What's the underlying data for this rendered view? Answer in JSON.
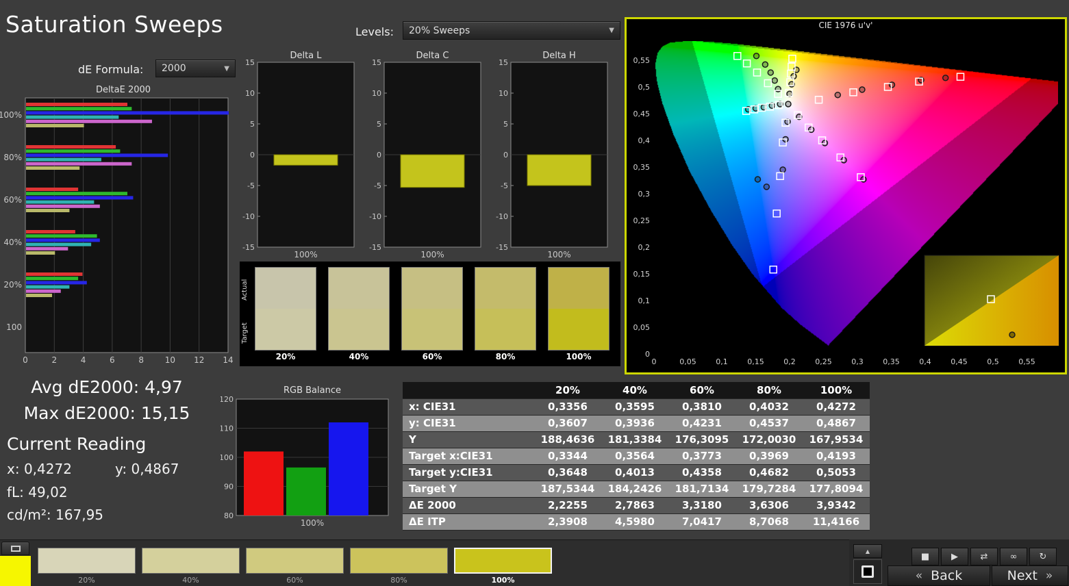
{
  "page": {
    "title": "Saturation Sweeps"
  },
  "colors": {
    "cie_border": "#ccd600",
    "panel_bg": "#000000",
    "body_bg": "#3c3c3c"
  },
  "controls": {
    "de_formula": {
      "label": "dE Formula:",
      "value": "2000"
    },
    "levels": {
      "label": "Levels:",
      "value": "20% Sweeps"
    }
  },
  "stats": {
    "avg_label": "Avg dE2000:",
    "avg_value": "4,97",
    "max_label": "Max dE2000:",
    "max_value": "15,15"
  },
  "current_reading": {
    "heading": "Current Reading",
    "x_label": "x:",
    "x_value": "0,4272",
    "y_label": "y:",
    "y_value": "0,4867",
    "fl_label": "fL:",
    "fl_value": "49,02",
    "cd_label": "cd/m²:",
    "cd_value": "167,95"
  },
  "chart_data": [
    {
      "id": "delta_e_2000",
      "type": "bar",
      "orientation": "horizontal",
      "title": "DeltaE 2000",
      "group_labels": [
        "100%",
        "80%",
        "60%",
        "40%",
        "20%",
        "100"
      ],
      "xlim": [
        0,
        14
      ],
      "xticks": [
        0,
        2,
        4,
        6,
        8,
        10,
        12,
        14
      ],
      "xtick_labels": [
        "0",
        "2",
        "4",
        "6",
        "8",
        "10",
        "12",
        "14"
      ],
      "series": [
        {
          "name": "red",
          "color": "#e03434",
          "values": [
            7.0,
            6.2,
            3.6,
            3.4,
            3.9,
            0
          ]
        },
        {
          "name": "green",
          "color": "#2eb82e",
          "values": [
            7.3,
            6.5,
            7.0,
            4.9,
            3.6,
            0
          ]
        },
        {
          "name": "blue",
          "color": "#2626e6",
          "values": [
            14.7,
            9.8,
            7.4,
            5.1,
            4.2,
            0
          ]
        },
        {
          "name": "cyan",
          "color": "#2fb3b3",
          "values": [
            6.4,
            5.2,
            4.7,
            4.5,
            3.0,
            0
          ]
        },
        {
          "name": "magenta",
          "color": "#cc66cc",
          "values": [
            8.7,
            7.3,
            5.1,
            2.9,
            2.4,
            0
          ]
        },
        {
          "name": "yellow",
          "color": "#b9b96a",
          "values": [
            4.0,
            3.7,
            3.0,
            2.0,
            1.8,
            0
          ]
        }
      ]
    },
    {
      "id": "delta_l",
      "type": "bar",
      "title": "Delta L",
      "categories": [
        "100%"
      ],
      "values": [
        -1.7
      ],
      "ylim": [
        -15,
        15
      ],
      "ytick_labels": [
        "15",
        "10",
        "5",
        "0",
        "-5",
        "-10",
        "-15"
      ],
      "xlabel": "100%",
      "bar_color": "#c4c41c"
    },
    {
      "id": "delta_c",
      "type": "bar",
      "title": "Delta C",
      "categories": [
        "100%"
      ],
      "values": [
        -5.3
      ],
      "ylim": [
        -15,
        15
      ],
      "ytick_labels": [
        "15",
        "10",
        "5",
        "0",
        "-5",
        "-10",
        "-15"
      ],
      "xlabel": "100%",
      "bar_color": "#c4c41c"
    },
    {
      "id": "delta_h",
      "type": "bar",
      "title": "Delta H",
      "categories": [
        "100%"
      ],
      "values": [
        -5.0
      ],
      "ylim": [
        -15,
        15
      ],
      "ytick_labels": [
        "15",
        "10",
        "5",
        "0",
        "-5",
        "-10",
        "-15"
      ],
      "xlabel": "100%",
      "bar_color": "#c4c41c"
    },
    {
      "id": "rgb_balance",
      "type": "bar",
      "title": "RGB Balance",
      "categories": [
        "Red",
        "Green",
        "Blue"
      ],
      "values": [
        102,
        96.5,
        112
      ],
      "colors": [
        "#ee1212",
        "#12a012",
        "#1616ee"
      ],
      "ylim": [
        80,
        120
      ],
      "yticks": [
        120,
        110,
        100,
        90,
        80
      ],
      "ytick_labels": [
        "120",
        "110",
        "100",
        "90",
        "80"
      ],
      "xlabel": "100%"
    },
    {
      "id": "cie_1976",
      "type": "scatter",
      "title": "CIE 1976 u'v'",
      "xlim": [
        0,
        0.6
      ],
      "ylim": [
        0,
        0.6
      ],
      "xtick_labels": [
        "0",
        "0,05",
        "0,1",
        "0,15",
        "0,2",
        "0,25",
        "0,3",
        "0,35",
        "0,4",
        "0,45",
        "0,5",
        "0,55"
      ],
      "ytick_labels": [
        "0",
        "0,05",
        "0,1",
        "0,15",
        "0,2",
        "0,25",
        "0,3",
        "0,35",
        "0,4",
        "0,45",
        "0,5",
        "0,55"
      ],
      "locus": [
        [
          0.2565,
          0.0165
        ],
        [
          0.2161,
          0.0549
        ],
        [
          0.1877,
          0.0871
        ],
        [
          0.1441,
          0.151
        ],
        [
          0.1147,
          0.2044
        ],
        [
          0.0828,
          0.2708
        ],
        [
          0.0521,
          0.3427
        ],
        [
          0.0282,
          0.4117
        ],
        [
          0.0119,
          0.4698
        ],
        [
          0.0035,
          0.5131
        ],
        [
          0.0014,
          0.5432
        ],
        [
          0.0046,
          0.5638
        ],
        [
          0.0123,
          0.577
        ],
        [
          0.0231,
          0.5837
        ],
        [
          0.0501,
          0.5868
        ],
        [
          0.0792,
          0.5856
        ],
        [
          0.1127,
          0.5821
        ],
        [
          0.1531,
          0.5765
        ],
        [
          0.2026,
          0.5693
        ],
        [
          0.2623,
          0.5604
        ],
        [
          0.3315,
          0.5501
        ],
        [
          0.4035,
          0.5393
        ],
        [
          0.4692,
          0.5296
        ],
        [
          0.5203,
          0.5219
        ],
        [
          0.5709,
          0.5143
        ],
        [
          0.6234,
          0.5065
        ]
      ],
      "gamut_triangle": [
        [
          0.0556,
          0.5868
        ],
        [
          0.5566,
          0.5165
        ],
        [
          0.1593,
          0.1258
        ]
      ],
      "target_squares": [
        [
          0.243,
          0.476
        ],
        [
          0.294,
          0.49
        ],
        [
          0.345,
          0.5
        ],
        [
          0.391,
          0.51
        ],
        [
          0.452,
          0.519
        ],
        [
          0.183,
          0.487
        ],
        [
          0.168,
          0.507
        ],
        [
          0.152,
          0.527
        ],
        [
          0.137,
          0.544
        ],
        [
          0.123,
          0.558
        ],
        [
          0.194,
          0.433
        ],
        [
          0.19,
          0.396
        ],
        [
          0.186,
          0.333
        ],
        [
          0.181,
          0.263
        ],
        [
          0.176,
          0.158
        ],
        [
          0.184,
          0.466
        ],
        [
          0.171,
          0.463
        ],
        [
          0.159,
          0.461
        ],
        [
          0.148,
          0.458
        ],
        [
          0.136,
          0.455
        ],
        [
          0.212,
          0.447
        ],
        [
          0.228,
          0.424
        ],
        [
          0.248,
          0.4
        ],
        [
          0.275,
          0.368
        ],
        [
          0.305,
          0.331
        ],
        [
          0.199,
          0.489
        ],
        [
          0.201,
          0.509
        ],
        [
          0.202,
          0.525
        ],
        [
          0.203,
          0.538
        ],
        [
          0.204,
          0.553
        ]
      ],
      "measured_points": [
        [
          0.271,
          0.485
        ],
        [
          0.307,
          0.495
        ],
        [
          0.351,
          0.504
        ],
        [
          0.394,
          0.513
        ],
        [
          0.43,
          0.517
        ],
        [
          0.183,
          0.496
        ],
        [
          0.178,
          0.512
        ],
        [
          0.172,
          0.527
        ],
        [
          0.164,
          0.542
        ],
        [
          0.151,
          0.558
        ],
        [
          0.197,
          0.435
        ],
        [
          0.194,
          0.402
        ],
        [
          0.19,
          0.345
        ],
        [
          0.166,
          0.313
        ],
        [
          0.153,
          0.327
        ],
        [
          0.186,
          0.468
        ],
        [
          0.174,
          0.465
        ],
        [
          0.162,
          0.462
        ],
        [
          0.15,
          0.46
        ],
        [
          0.139,
          0.458
        ],
        [
          0.214,
          0.444
        ],
        [
          0.232,
          0.42
        ],
        [
          0.252,
          0.395
        ],
        [
          0.28,
          0.363
        ],
        [
          0.309,
          0.327
        ],
        [
          0.2,
          0.487
        ],
        [
          0.203,
          0.505
        ],
        [
          0.206,
          0.52
        ],
        [
          0.21,
          0.532
        ],
        [
          0.198,
          0.468
        ]
      ],
      "inset": {
        "base_colors": [
          "#45450a",
          "#bcbc10"
        ],
        "tri_colors": [
          "#dcdc06",
          "#d88f00"
        ],
        "square": [
          535,
          412
        ],
        "circle": [
          566,
          464
        ]
      }
    }
  ],
  "swatch_compare": {
    "row_labels": [
      "Actual",
      "Target"
    ],
    "items": [
      {
        "label": "20%",
        "actual": "#c8c5ab",
        "target": "#ccc9a6"
      },
      {
        "label": "40%",
        "actual": "#c8c399",
        "target": "#cac590"
      },
      {
        "label": "60%",
        "actual": "#c6bf83",
        "target": "#c8c277"
      },
      {
        "label": "80%",
        "actual": "#c4bb6b",
        "target": "#c6bf59"
      },
      {
        "label": "100%",
        "actual": "#bfb148",
        "target": "#c2bc1d"
      }
    ]
  },
  "table": {
    "headers": [
      "",
      "20%",
      "40%",
      "60%",
      "80%",
      "100%"
    ],
    "rows": [
      {
        "label": "x: CIE31",
        "values": [
          "0,3356",
          "0,3595",
          "0,3810",
          "0,4032",
          "0,4272"
        ]
      },
      {
        "label": "y: CIE31",
        "values": [
          "0,3607",
          "0,3936",
          "0,4231",
          "0,4537",
          "0,4867"
        ]
      },
      {
        "label": "Y",
        "values": [
          "188,4636",
          "181,3384",
          "176,3095",
          "172,0030",
          "167,9534"
        ]
      },
      {
        "label": "Target x:CIE31",
        "values": [
          "0,3344",
          "0,3564",
          "0,3773",
          "0,3969",
          "0,4193"
        ]
      },
      {
        "label": "Target y:CIE31",
        "values": [
          "0,3648",
          "0,4013",
          "0,4358",
          "0,4682",
          "0,5053"
        ]
      },
      {
        "label": "Target Y",
        "values": [
          "187,5344",
          "184,2426",
          "181,7134",
          "179,7284",
          "177,8094"
        ]
      },
      {
        "label": "ΔE 2000",
        "values": [
          "2,2255",
          "2,7863",
          "3,3180",
          "3,6306",
          "3,9342"
        ]
      },
      {
        "label": "ΔE ITP",
        "values": [
          "2,3908",
          "4,5980",
          "7,0417",
          "8,7068",
          "11,4166"
        ]
      }
    ]
  },
  "bottom_bar": {
    "current_color": "#f6f600",
    "tiles": [
      {
        "label": "20%",
        "color": "#d8d5b8",
        "selected": false
      },
      {
        "label": "40%",
        "color": "#d4d09c",
        "selected": false
      },
      {
        "label": "60%",
        "color": "#d0ca7f",
        "selected": false
      },
      {
        "label": "80%",
        "color": "#ccc35c",
        "selected": false
      },
      {
        "label": "100%",
        "color": "#c9c31c",
        "selected": true
      }
    ],
    "transport": [
      {
        "name": "stop-button",
        "icon": "stop-icon",
        "glyph": "■"
      },
      {
        "name": "play-button",
        "icon": "play-icon",
        "glyph": "▶"
      },
      {
        "name": "step-button",
        "icon": "step-icon",
        "glyph": "⇄"
      },
      {
        "name": "loop-button",
        "icon": "infinity-icon",
        "glyph": "∞"
      },
      {
        "name": "refresh-button",
        "icon": "refresh-icon",
        "glyph": "↻"
      }
    ],
    "back": {
      "label": "Back",
      "arrow": "«"
    },
    "next": {
      "label": "Next",
      "arrow": "»"
    }
  }
}
